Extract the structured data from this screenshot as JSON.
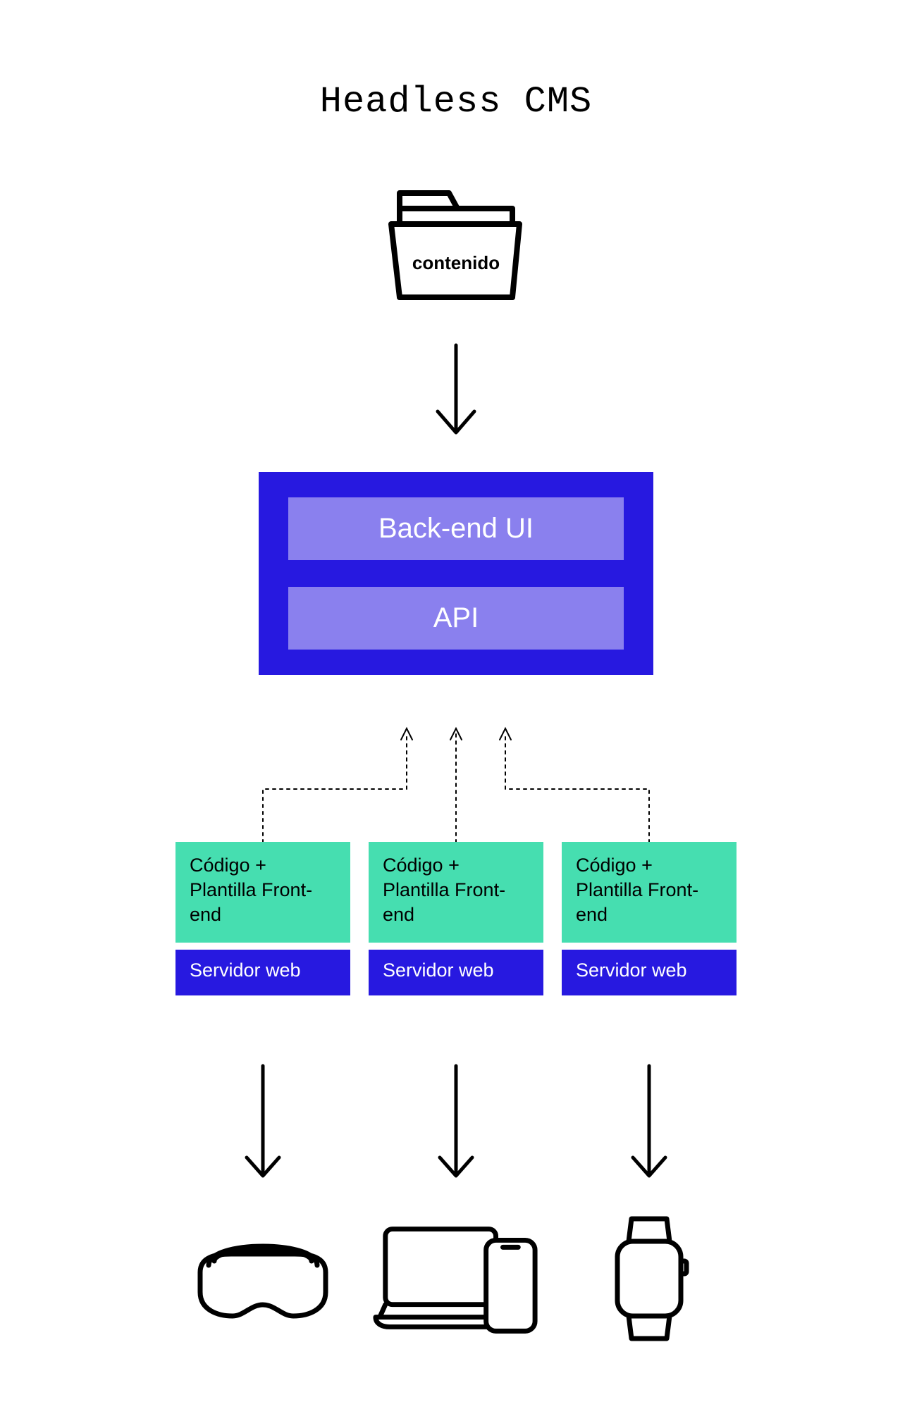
{
  "title": "Headless CMS",
  "folder": {
    "label": "contenido"
  },
  "backend": {
    "rows": [
      "Back-end UI",
      "API"
    ]
  },
  "channels": [
    {
      "code_label": "Código + Plantilla Front-end",
      "server_label": "Servidor web",
      "device": "vr-headset"
    },
    {
      "code_label": "Código + Plantilla Front-end",
      "server_label": "Servidor web",
      "device": "laptop-phone"
    },
    {
      "code_label": "Código + Plantilla Front-end",
      "server_label": "Servidor web",
      "device": "smartwatch"
    }
  ],
  "colors": {
    "blue": "#2719e0",
    "lavender": "#8a80ee",
    "mint": "#46deb0"
  }
}
